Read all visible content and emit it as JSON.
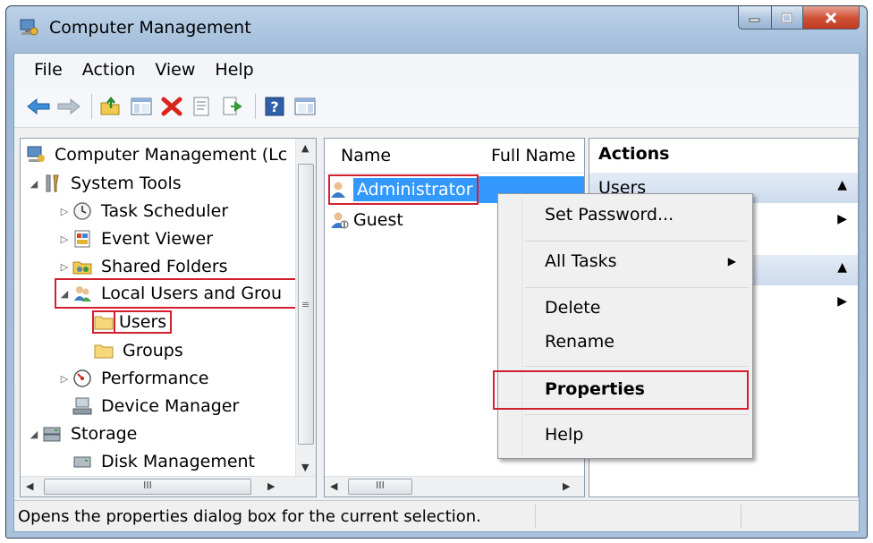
{
  "window": {
    "title": "Computer Management"
  },
  "menubar": [
    "File",
    "Action",
    "View",
    "Help"
  ],
  "toolbar": {
    "icons": [
      "back-arrow-icon",
      "forward-arrow-icon",
      "up-folder-icon",
      "show-hide-tree-icon",
      "delete-icon",
      "properties-icon",
      "export-list-icon",
      "help-icon",
      "show-hide-action-pane-icon"
    ]
  },
  "tree": {
    "items": [
      {
        "label": "Computer Management (Lc",
        "icon": "computer-management-icon"
      },
      {
        "label": "System Tools",
        "icon": "system-tools-icon"
      },
      {
        "label": "Task Scheduler",
        "icon": "clock-icon"
      },
      {
        "label": "Event Viewer",
        "icon": "event-viewer-icon"
      },
      {
        "label": "Shared Folders",
        "icon": "shared-folders-icon"
      },
      {
        "label": "Local Users and Grou",
        "icon": "users-group-icon"
      },
      {
        "label": "Users",
        "icon": "folder-icon"
      },
      {
        "label": "Groups",
        "icon": "folder-icon"
      },
      {
        "label": "Performance",
        "icon": "performance-icon"
      },
      {
        "label": "Device Manager",
        "icon": "device-manager-icon"
      },
      {
        "label": "Storage",
        "icon": "storage-icon"
      },
      {
        "label": "Disk Management",
        "icon": "disk-icon"
      }
    ]
  },
  "list": {
    "columns": [
      "Name",
      "Full Name"
    ],
    "rows": [
      {
        "name": "Administrator",
        "icon": "user-icon",
        "selected": true
      },
      {
        "name": "Guest",
        "icon": "user-icon",
        "selected": false
      }
    ]
  },
  "actions": {
    "title": "Actions",
    "sections": [
      "Users",
      ""
    ]
  },
  "context_menu": {
    "items": [
      "Set Password...",
      "All Tasks",
      "Delete",
      "Rename",
      "Properties",
      "Help"
    ]
  },
  "status": {
    "text": "Opens the properties dialog box for the current selection."
  },
  "colors": {
    "highlight": "#d3202f",
    "selection": "#3399ff"
  }
}
